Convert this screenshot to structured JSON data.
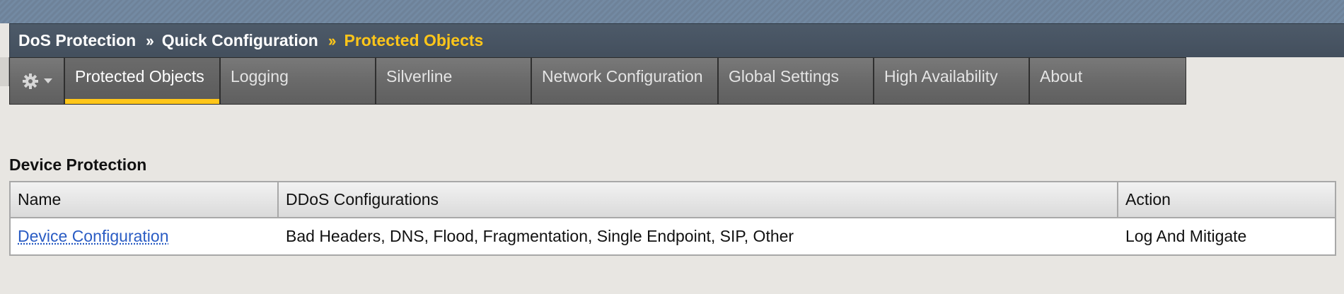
{
  "breadcrumb": {
    "items": [
      "DoS Protection",
      "Quick Configuration",
      "Protected Objects"
    ],
    "separator": "››"
  },
  "tabs": [
    {
      "label": "Protected Objects",
      "active": true
    },
    {
      "label": "Logging",
      "active": false
    },
    {
      "label": "Silverline",
      "active": false
    },
    {
      "label": "Network Configuration",
      "active": false
    },
    {
      "label": "Global Settings",
      "active": false
    },
    {
      "label": "High Availability",
      "active": false
    },
    {
      "label": "About",
      "active": false
    }
  ],
  "gear_menu": {
    "icon": "gear-icon",
    "dropdown_icon": "chevron-down-icon"
  },
  "section": {
    "title": "Device Protection"
  },
  "table": {
    "headers": [
      "Name",
      "DDoS Configurations",
      "Action"
    ],
    "rows": [
      {
        "name": "Device Configuration",
        "ddos": "Bad Headers, DNS, Flood, Fragmentation, Single Endpoint, SIP, Other",
        "action": "Log And Mitigate"
      }
    ]
  },
  "colors": {
    "accent": "#ffc619",
    "header_bar": "#4d5a69",
    "link": "#2a5cc4"
  }
}
